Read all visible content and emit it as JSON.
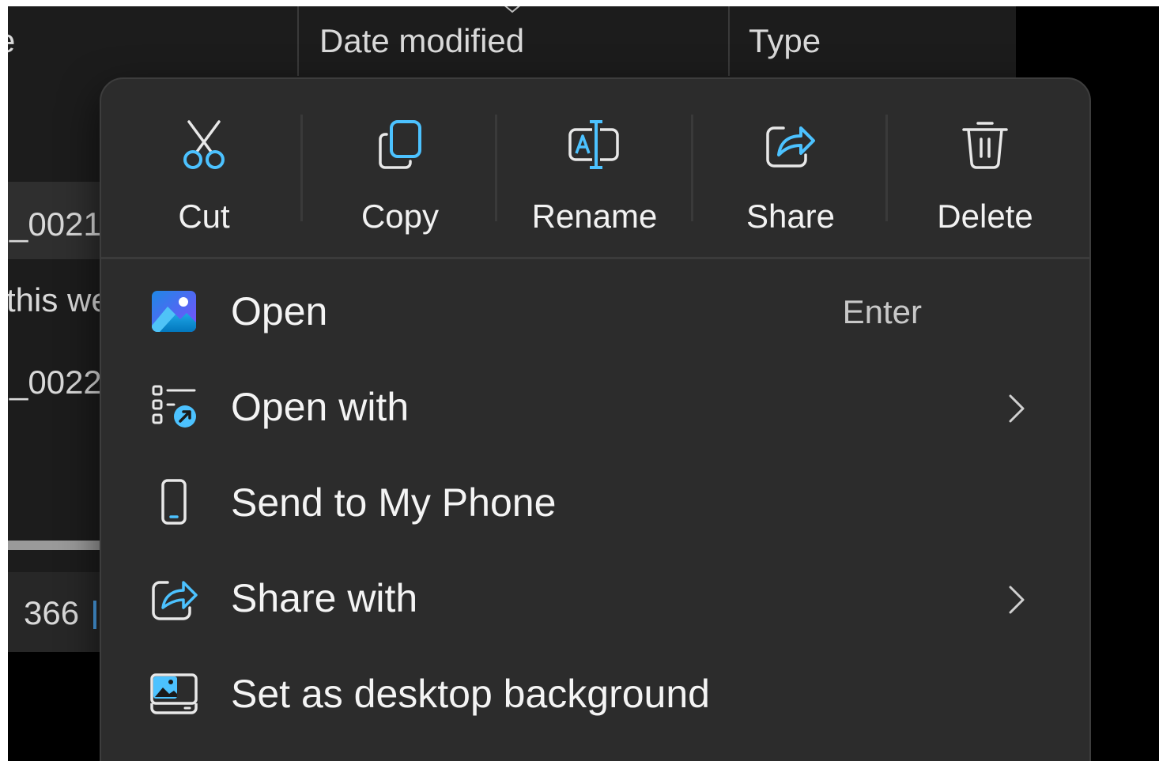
{
  "explorer": {
    "columns": {
      "name_fragment": "e",
      "date_modified": "Date modified",
      "type": "Type"
    },
    "rows": [
      {
        "name_fragment": "_0021"
      },
      {
        "name_fragment": "this we"
      },
      {
        "name_fragment": "_0022"
      }
    ],
    "status": {
      "count": "366"
    }
  },
  "context_menu": {
    "quick_actions": {
      "cut": "Cut",
      "copy": "Copy",
      "rename": "Rename",
      "share": "Share",
      "delete": "Delete"
    },
    "items": [
      {
        "label": "Open",
        "shortcut": "Enter",
        "icon": "photos-app-icon"
      },
      {
        "label": "Open with",
        "icon": "open-with-icon",
        "has_submenu": true
      },
      {
        "label": "Send to My Phone",
        "icon": "phone-icon"
      },
      {
        "label": "Share with",
        "icon": "share-icon",
        "has_submenu": true
      },
      {
        "label": "Set as desktop background",
        "icon": "desktop-background-icon"
      }
    ]
  },
  "colors": {
    "accent": "#4cc2ff",
    "menu_background": "#2c2c2c",
    "explorer_background": "#1c1c1c"
  }
}
